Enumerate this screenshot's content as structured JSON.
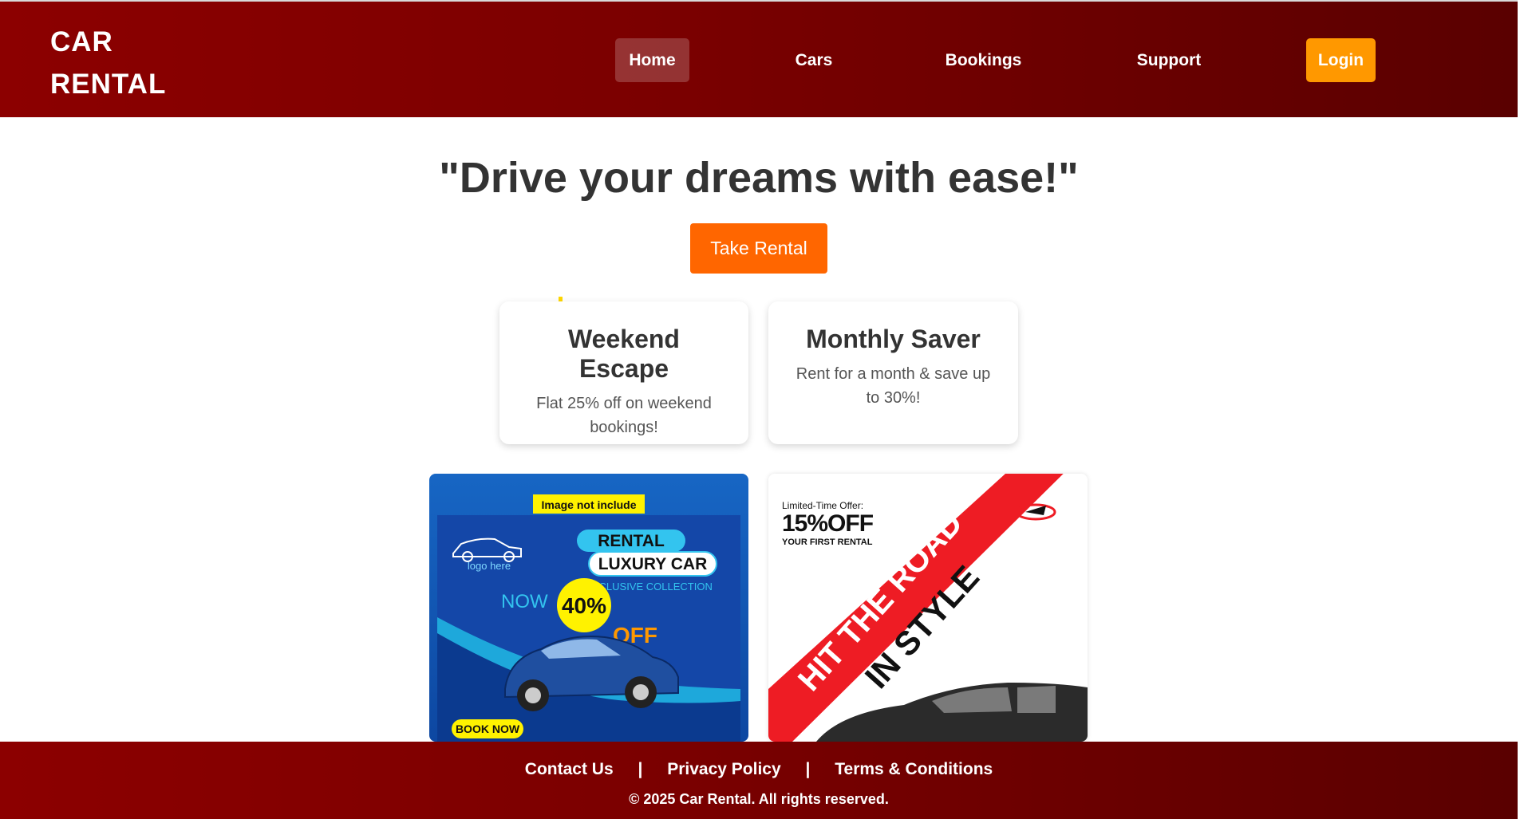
{
  "header": {
    "logo_line1": "CAR",
    "logo_line2": "RENTAL",
    "nav": [
      "Home",
      "Cars",
      "Bookings",
      "Support"
    ],
    "login_label": "Login"
  },
  "hero": {
    "tagline": "\"Drive your dreams with ease!\"",
    "cta_label": "Take Rental"
  },
  "offers": [
    {
      "title": "Weekend Escape",
      "description": "Flat 25% off on weekend bookings!"
    },
    {
      "title": "Monthly Saver",
      "description": "Rent for a month & save up to 30%!"
    }
  ],
  "posters": {
    "poster1": {
      "badge": "Image not include",
      "logo_text": "logo here",
      "tag1": "RENTAL",
      "tag2": "LUXURY CAR",
      "subtitle": "EXCLUSIVE COLLECTION",
      "now": "NOW",
      "discount": "40%",
      "off": "OFF",
      "cta": "BOOK NOW"
    },
    "poster2": {
      "limited": "Limited-Time Offer:",
      "percent": "15%OFF",
      "first": "YOUR FIRST RENTAL",
      "banner": "HIT THE ROAD",
      "style": "IN STYLE"
    }
  },
  "footer": {
    "links": [
      "Contact Us",
      "Privacy Policy",
      "Terms & Conditions"
    ],
    "separator": "|",
    "copyright": "© 2025 Car Rental. All rights reserved."
  },
  "colors": {
    "primary": "#8c0000",
    "login": "#ff9800",
    "cta": "#ff6600"
  }
}
